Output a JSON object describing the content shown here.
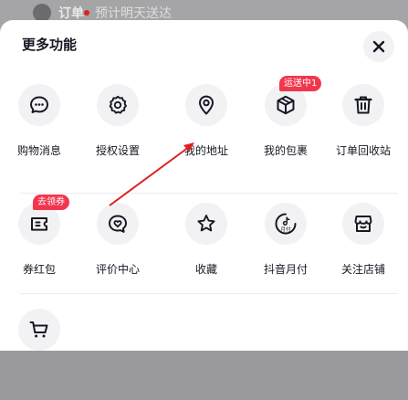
{
  "background": {
    "header_text": "订单",
    "header_sub": "预计明天送达"
  },
  "panel": {
    "title": "更多功能",
    "close_icon": "close-icon"
  },
  "row1": [
    {
      "label": "购物消息",
      "icon": "message-icon"
    },
    {
      "label": "授权设置",
      "icon": "gear-icon"
    },
    {
      "label": "我的地址",
      "icon": "location-pin-icon"
    },
    {
      "label": "我的包裹",
      "icon": "package-icon",
      "badge": "运送中1"
    },
    {
      "label": "订单回收站",
      "icon": "trash-icon"
    }
  ],
  "row2": [
    {
      "label": "券红包",
      "icon": "coupon-icon",
      "badge": "去领券"
    },
    {
      "label": "评价中心",
      "icon": "review-heart-icon"
    },
    {
      "label": "收藏",
      "icon": "star-icon"
    },
    {
      "label": "抖音月付",
      "icon": "monthly-pay-icon",
      "icon_text": "月付"
    },
    {
      "label": "关注店铺",
      "icon": "store-icon"
    }
  ],
  "row3": [
    {
      "label": "",
      "icon": "cart-icon"
    }
  ],
  "colors": {
    "badge": "#f2364d",
    "annotation_arrow": "#e02020",
    "icon_stroke": "#161823",
    "circle_bg": "#f2f2f4"
  }
}
